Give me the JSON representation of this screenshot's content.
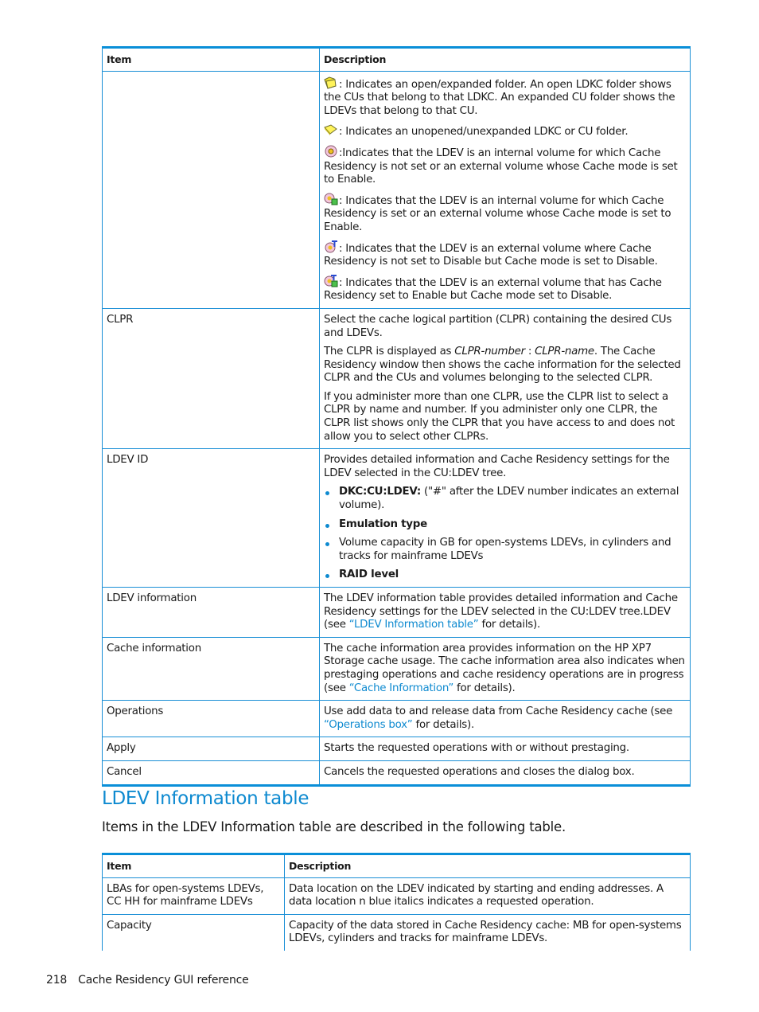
{
  "table1": {
    "headers": {
      "item": "Item",
      "description": "Description"
    },
    "icon_legend": [
      {
        "icon": "open-folder-icon",
        "text": ": Indicates an open/expanded folder. An open LDKC folder shows the CUs that belong to that LDKC. An expanded CU folder shows the LDEVs that belong to that CU."
      },
      {
        "icon": "closed-folder-icon",
        "text": ": Indicates an unopened/unexpanded LDKC or CU folder."
      },
      {
        "icon": "ldev-internal-icon",
        "text": ":Indicates that the LDEV is an internal volume for which Cache Residency is not set or an external volume whose Cache mode is set to Enable."
      },
      {
        "icon": "ldev-residency-set-icon",
        "text": ": Indicates that the LDEV is an internal volume for which Cache Residency is set or an external volume whose Cache mode is set to Enable."
      },
      {
        "icon": "ldev-external-icon",
        "text": ": Indicates that the LDEV is an external volume where Cache Residency is not set to Disable but Cache mode is set to Disable."
      },
      {
        "icon": "ldev-external-residency-icon",
        "text": ": Indicates that the LDEV is an external volume that has Cache Residency set to Enable but Cache mode set to Disable."
      }
    ],
    "clpr": {
      "item": "CLPR",
      "p1": "Select the cache logical partition (CLPR) containing the desired CUs and LDEVs.",
      "p2_pre": "The CLPR is displayed as ",
      "p2_italic1": "CLPR-number",
      "p2_mid": " : ",
      "p2_italic2": "CLPR-name",
      "p2_post": ". The Cache Residency window then shows the cache information for the selected CLPR and the CUs and volumes belonging to the selected CLPR.",
      "p3": "If you administer more than one CLPR, use the CLPR list to select a CLPR by name and number. If you administer only one CLPR, the CLPR list shows only the CLPR that you have access to and does not allow you to select other CLPRs."
    },
    "ldev_id": {
      "item": "LDEV ID",
      "intro": "Provides detailed information and Cache Residency settings for the LDEV selected in the CU:LDEV tree.",
      "b1_bold": "DKC:CU:LDEV:",
      "b1_text": " (\"#\" after the LDEV number indicates an external volume).",
      "b2_bold": "Emulation type",
      "b3_text": "Volume capacity in GB for open-systems LDEVs, in cylinders and tracks for mainframe LDEVs",
      "b4_bold": "RAID level"
    },
    "ldev_information": {
      "item": "LDEV information",
      "pre": "The LDEV information table provides detailed information and Cache Residency settings for the LDEV selected in the CU:LDEV tree.LDEV (see ",
      "link": "“LDEV Information table”",
      "post": " for details)."
    },
    "cache_information": {
      "item": "Cache information",
      "pre": "The cache information area provides information on the HP XP7 Storage cache usage. The cache information area also indicates when prestaging operations and cache residency operations are in progress (see ",
      "link": "“Cache Information”",
      "post": " for details)."
    },
    "operations": {
      "item": "Operations",
      "pre": "Use add data to and release data from Cache Residency cache (see ",
      "link": "“Operations box”",
      "post": " for details)."
    },
    "apply": {
      "item": "Apply",
      "description": "Starts the requested operations with or without prestaging."
    },
    "cancel": {
      "item": "Cancel",
      "description": "Cancels the requested operations and closes the dialog box."
    }
  },
  "section": {
    "heading": "LDEV Information table",
    "intro": "Items in the LDEV Information table are described in the following table."
  },
  "table2": {
    "headers": {
      "item": "Item",
      "description": "Description"
    },
    "rows": [
      {
        "item": "LBAs for open-systems LDEVs, CC HH for mainframe LDEVs",
        "description": "Data location on the LDEV indicated by starting and ending addresses. A data location n blue italics indicates a requested operation."
      },
      {
        "item": "Capacity",
        "description": "Capacity of the data stored in Cache Residency cache: MB for open-systems LDEVs, cylinders and tracks for mainframe LDEVs."
      }
    ]
  },
  "footer": {
    "page_number": "218",
    "title": "Cache Residency GUI reference"
  },
  "colors": {
    "accent": "#0e8ad0",
    "rule": "#1a8fd6",
    "text": "#1a1a1a"
  }
}
